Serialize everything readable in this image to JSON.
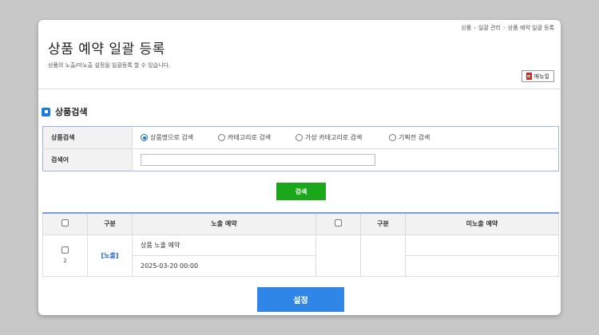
{
  "breadcrumb": [
    "상품",
    "일괄 관리",
    "상품 예약 일괄 등록"
  ],
  "page": {
    "title": "상품 예약 일괄 등록",
    "description": "상품의 노출/미노출 설정을 일괄등록 할 수 있습니다.",
    "manual_label": "매뉴얼"
  },
  "search": {
    "section_title": "상품검색",
    "type_label": "상품검색",
    "options": [
      "상품명으로 검색",
      "카테고리로 검색",
      "가상 카테고리로 검색",
      "기획전 검색"
    ],
    "selected_index": 0,
    "keyword_label": "검색어",
    "keyword_value": "",
    "search_button": "검색"
  },
  "results": {
    "headers": [
      "구분",
      "노출 예약",
      "구분",
      "미노출 예약"
    ],
    "rows": [
      {
        "num": "2",
        "kind": "[노출]",
        "product": "상품 노출 예약",
        "datetime": "2025-03-20 00:00"
      }
    ]
  },
  "apply_button": "설정",
  "colors": {
    "primary_blue": "#2f86e6",
    "search_green": "#1aa81a",
    "pdf_red": "#d9231c",
    "section_icon": "#1a7be0"
  }
}
